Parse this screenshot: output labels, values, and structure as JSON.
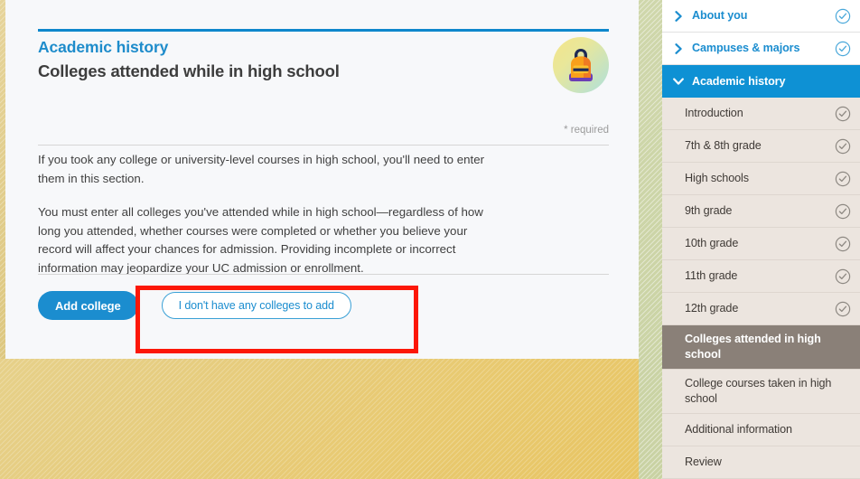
{
  "page": {
    "eyebrow": "Academic history",
    "title": "Colleges attended while in high school",
    "required_note": "* required",
    "paragraph_1": "If you took any college or university-level courses in high school, you'll need to enter them in this section.",
    "paragraph_2": "You must enter all colleges you've attended while in high school—regardless of how long you attended, whether courses were completed or whether you believe your record will affect your chances for admission. Providing incomplete or incorrect information may jeopardize your UC admission or enrollment.",
    "medallion_icon": "backpack-icon"
  },
  "actions": {
    "primary_label": "Add college",
    "secondary_label": "I don't have any colleges to add"
  },
  "annotation": {
    "highlight_color": "#fc1707"
  },
  "colors": {
    "accent_blue": "#1b8dcf",
    "section_open_blue": "#0e91d4",
    "active_row_gray": "#8a8078",
    "sidebar_bg": "#ece5df",
    "backdrop_gold": "#e7c158",
    "side_strip_green": "#cdd5a8"
  },
  "sidebar": {
    "items": [
      {
        "label": "About you",
        "type": "section",
        "icon": "chevron-right-icon",
        "check": true,
        "check_style": "blue"
      },
      {
        "label": "Campuses & majors",
        "type": "section",
        "icon": "chevron-right-icon",
        "check": true,
        "check_style": "blue"
      },
      {
        "label": "Academic history",
        "type": "section-open",
        "icon": "chevron-down-icon",
        "check": false,
        "check_style": "none"
      },
      {
        "label": "Introduction",
        "type": "sub",
        "icon": "none",
        "check": true,
        "check_style": "gray"
      },
      {
        "label": "7th & 8th grade",
        "type": "sub",
        "icon": "none",
        "check": true,
        "check_style": "gray"
      },
      {
        "label": "High schools",
        "type": "sub",
        "icon": "none",
        "check": true,
        "check_style": "gray"
      },
      {
        "label": "9th grade",
        "type": "sub",
        "icon": "none",
        "check": true,
        "check_style": "gray"
      },
      {
        "label": "10th grade",
        "type": "sub",
        "icon": "none",
        "check": true,
        "check_style": "gray"
      },
      {
        "label": "11th grade",
        "type": "sub",
        "icon": "none",
        "check": true,
        "check_style": "gray"
      },
      {
        "label": "12th grade",
        "type": "sub",
        "icon": "none",
        "check": true,
        "check_style": "gray"
      },
      {
        "label": "Colleges attended in high school",
        "type": "sub-active",
        "icon": "none",
        "check": false,
        "check_style": "none"
      },
      {
        "label": "College courses taken in high school",
        "type": "sub",
        "icon": "none",
        "check": false,
        "check_style": "none"
      },
      {
        "label": "Additional information",
        "type": "sub",
        "icon": "none",
        "check": false,
        "check_style": "none"
      },
      {
        "label": "Review",
        "type": "sub",
        "icon": "none",
        "check": false,
        "check_style": "none"
      }
    ]
  }
}
